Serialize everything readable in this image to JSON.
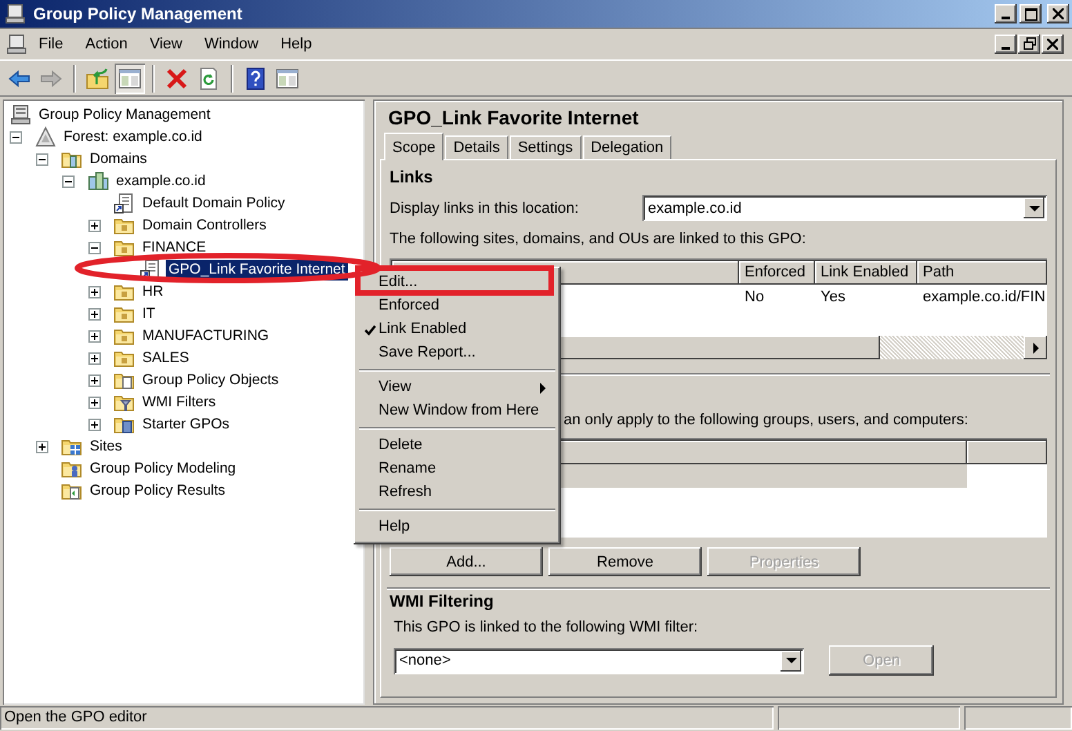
{
  "window": {
    "title": "Group Policy Management"
  },
  "menu_bar": [
    "File",
    "Action",
    "View",
    "Window",
    "Help"
  ],
  "toolbar_groups": [
    {
      "buttons": [
        {
          "kind": "back",
          "disabled": false,
          "pressed": false
        },
        {
          "kind": "forward",
          "disabled": true,
          "pressed": false
        }
      ]
    },
    {
      "buttons": [
        {
          "kind": "up",
          "disabled": false,
          "pressed": false
        },
        {
          "kind": "tree",
          "disabled": false,
          "pressed": true
        }
      ]
    },
    {
      "buttons": [
        {
          "kind": "delete",
          "disabled": false,
          "pressed": false
        },
        {
          "kind": "refresh",
          "disabled": false,
          "pressed": false
        }
      ]
    },
    {
      "buttons": [
        {
          "kind": "help",
          "disabled": false,
          "pressed": false
        },
        {
          "kind": "pane",
          "disabled": false,
          "pressed": false
        }
      ]
    }
  ],
  "tree": [
    {
      "label": "Group Policy Management",
      "kind": "console",
      "selected": false,
      "children": [
        {
          "label": "Forest: example.co.id",
          "kind": "forest",
          "selected": false,
          "expanded": true,
          "children": [
            {
              "label": "Domains",
              "kind": "domains",
              "selected": false,
              "expanded": true,
              "children": [
                {
                  "label": "example.co.id",
                  "kind": "domain",
                  "selected": false,
                  "expanded": true,
                  "children": [
                    {
                      "label": "Default Domain Policy",
                      "kind": "gpo",
                      "selected": false
                    },
                    {
                      "label": "Domain Controllers",
                      "kind": "ou",
                      "selected": false,
                      "expanded": false
                    },
                    {
                      "label": "FINANCE",
                      "kind": "ou",
                      "selected": false,
                      "expanded": true,
                      "children": [
                        {
                          "label": "GPO_Link Favorite Internet",
                          "kind": "gpo",
                          "selected": true
                        }
                      ]
                    },
                    {
                      "label": "HR",
                      "kind": "ou",
                      "selected": false,
                      "expanded": false
                    },
                    {
                      "label": "IT",
                      "kind": "ou",
                      "selected": false,
                      "expanded": false
                    },
                    {
                      "label": "MANUFACTURING",
                      "kind": "ou",
                      "selected": false,
                      "expanded": false
                    },
                    {
                      "label": "SALES",
                      "kind": "ou",
                      "selected": false,
                      "expanded": false
                    },
                    {
                      "label": "Group Policy Objects",
                      "kind": "gpo-folder",
                      "selected": false,
                      "expanded": false
                    },
                    {
                      "label": "WMI Filters",
                      "kind": "wmi-folder",
                      "selected": false,
                      "expanded": false
                    },
                    {
                      "label": "Starter GPOs",
                      "kind": "starter-folder",
                      "selected": false,
                      "expanded": false
                    }
                  ]
                }
              ]
            },
            {
              "label": "Sites",
              "kind": "sites",
              "selected": false,
              "expanded": false
            },
            {
              "label": "Group Policy Modeling",
              "kind": "modeling",
              "selected": false
            },
            {
              "label": "Group Policy Results",
              "kind": "results",
              "selected": false
            }
          ]
        }
      ]
    }
  ],
  "details": {
    "title": "GPO_Link Favorite Internet",
    "tabs": [
      {
        "label": "Scope",
        "selected": true
      },
      {
        "label": "Details",
        "selected": false
      },
      {
        "label": "Settings",
        "selected": false
      },
      {
        "label": "Delegation",
        "selected": false
      }
    ],
    "links": {
      "heading": "Links",
      "location_label": "Display links in this location:",
      "location_value": "example.co.id",
      "list_caption": "The following sites, domains, and OUs are linked to this GPO:",
      "columns": [
        "Enforced",
        "Link Enabled",
        "Path"
      ],
      "rows": [
        {
          "cells": [
            "No",
            "Yes",
            "example.co.id/FIN"
          ],
          "selected": false
        }
      ]
    },
    "security_filtering": {
      "caption": "an only apply to the following groups, users, and computers:",
      "rows": [
        {
          "selected": true
        }
      ],
      "buttons": [
        {
          "label": "Add...",
          "disabled": false
        },
        {
          "label": "Remove",
          "disabled": false
        },
        {
          "label": "Properties",
          "disabled": true
        }
      ]
    },
    "wmi_filtering": {
      "heading": "WMI Filtering",
      "caption": "This GPO is linked to the following WMI filter:",
      "value": "<none>",
      "button": {
        "label": "Open",
        "disabled": true
      }
    }
  },
  "context_menu": [
    {
      "kind": "item",
      "label": "Edit...",
      "checked": false,
      "submenu": false
    },
    {
      "kind": "item",
      "label": "Enforced",
      "checked": false,
      "submenu": false
    },
    {
      "kind": "item",
      "label": "Link Enabled",
      "checked": true,
      "submenu": false
    },
    {
      "kind": "item",
      "label": "Save Report...",
      "checked": false,
      "submenu": false
    },
    {
      "kind": "separator"
    },
    {
      "kind": "item",
      "label": "View",
      "checked": false,
      "submenu": true
    },
    {
      "kind": "item",
      "label": "New Window from Here",
      "checked": false,
      "submenu": false
    },
    {
      "kind": "separator"
    },
    {
      "kind": "item",
      "label": "Delete",
      "checked": false,
      "submenu": false
    },
    {
      "kind": "item",
      "label": "Rename",
      "checked": false,
      "submenu": false
    },
    {
      "kind": "item",
      "label": "Refresh",
      "checked": false,
      "submenu": false
    },
    {
      "kind": "separator"
    },
    {
      "kind": "item",
      "label": "Help",
      "checked": false,
      "submenu": false
    }
  ],
  "annotations": [
    {
      "kind": "ellipse"
    },
    {
      "kind": "rectangle"
    }
  ],
  "status_bar": {
    "text": "Open the GPO editor"
  }
}
